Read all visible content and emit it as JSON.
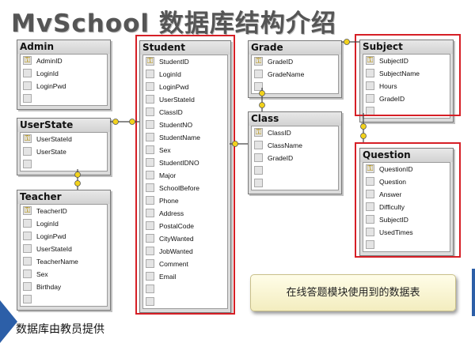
{
  "title": "MvSchool 数据库结构介绍",
  "tables": {
    "admin": {
      "name": "Admin",
      "fields": [
        "AdminID",
        "LoginId",
        "LoginPwd"
      ]
    },
    "userstate": {
      "name": "UserState",
      "fields": [
        "UserStateId",
        "UserState"
      ]
    },
    "teacher": {
      "name": "Teacher",
      "fields": [
        "TeacherID",
        "LoginId",
        "LoginPwd",
        "UserStateId",
        "TeacherName",
        "Sex",
        "Birthday"
      ]
    },
    "student": {
      "name": "Student",
      "fields": [
        "StudentID",
        "LoginId",
        "LoginPwd",
        "UserStateId",
        "ClassID",
        "StudentNO",
        "StudentName",
        "Sex",
        "StudentIDNO",
        "Major",
        "SchoolBefore",
        "Phone",
        "Address",
        "PostalCode",
        "CityWanted",
        "JobWanted",
        "Comment",
        "Email"
      ]
    },
    "grade": {
      "name": "Grade",
      "fields": [
        "GradeID",
        "GradeName"
      ]
    },
    "class": {
      "name": "Class",
      "fields": [
        "ClassID",
        "ClassName",
        "GradeID"
      ]
    },
    "subject": {
      "name": "Subject",
      "fields": [
        "SubjectID",
        "SubjectName",
        "Hours",
        "GradeID"
      ]
    },
    "question": {
      "name": "Question",
      "fields": [
        "QuestionID",
        "Question",
        "Answer",
        "Difficulty",
        "SubjectID",
        "UsedTimes"
      ]
    }
  },
  "note": "在线答题模块使用到的数据表",
  "footer": "数据库由教员提供",
  "colors": {
    "highlight": "#d61f26",
    "key": "#b08a00",
    "accent": "#2c5fa8"
  }
}
